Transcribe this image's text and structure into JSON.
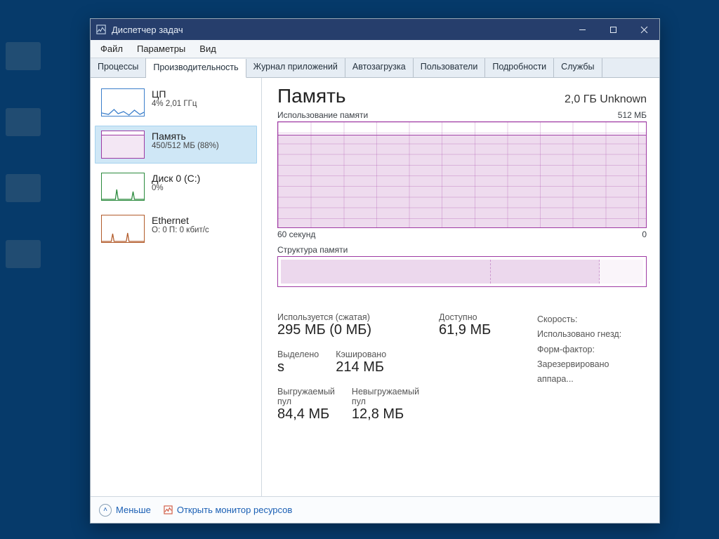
{
  "window": {
    "title": "Диспетчер задач"
  },
  "winctrl": {
    "min": "–",
    "max": "▢",
    "close": "✕"
  },
  "menu": {
    "file": "Файл",
    "options": "Параметры",
    "view": "Вид"
  },
  "tabs": {
    "processes": "Процессы",
    "performance": "Производительность",
    "app_history": "Журнал приложений",
    "startup": "Автозагрузка",
    "users": "Пользователи",
    "details": "Подробности",
    "services": "Службы"
  },
  "sidebar": {
    "cpu": {
      "title": "ЦП",
      "sub": "4% 2,01 ГГц"
    },
    "mem": {
      "title": "Память",
      "sub": "450/512 МБ (88%)"
    },
    "disk": {
      "title": "Диск 0 (C:)",
      "sub": "0%"
    },
    "net": {
      "title": "Ethernet",
      "sub": "О: 0 П: 0 кбит/с"
    }
  },
  "main": {
    "title": "Память",
    "installed": "2,0 ГБ Unknown",
    "usage_label": "Использование памяти",
    "usage_max": "512 МБ",
    "axis_left": "60 секунд",
    "axis_right": "0",
    "composition_label": "Структура памяти"
  },
  "stats": {
    "in_use_label": "Используется (сжатая)",
    "in_use_value": "295 МБ (0 МБ)",
    "avail_label": "Доступно",
    "avail_value": "61,9 МБ",
    "committed_label": "Выделено",
    "committed_value": "s",
    "cached_label": "Кэшировано",
    "cached_value": "214 МБ",
    "paged_label": "Выгружаемый пул",
    "paged_value": "84,4 МБ",
    "nonpaged_label": "Невыгружаемый пул",
    "nonpaged_value": "12,8 МБ",
    "right_list": {
      "speed": "Скорость:",
      "slots": "Использовано гнезд:",
      "form": "Форм-фактор:",
      "reserved": "Зарезервировано аппара..."
    }
  },
  "footer": {
    "fewer": "Меньше",
    "resmon": "Открыть монитор ресурсов"
  },
  "chart_data": {
    "type": "line",
    "title": "Использование памяти",
    "xlabel": "60 секунд",
    "ylabel": "",
    "ylim": [
      0,
      512
    ],
    "x": [
      60,
      55,
      50,
      45,
      40,
      35,
      30,
      25,
      20,
      15,
      10,
      5,
      0
    ],
    "values": [
      450,
      450,
      450,
      450,
      450,
      450,
      450,
      450,
      450,
      450,
      450,
      450,
      450
    ],
    "unit": "МБ",
    "fill_pct": 88
  },
  "composition_data": {
    "type": "bar",
    "segments": [
      {
        "name": "used",
        "pct": 58
      },
      {
        "name": "cached",
        "pct": 30
      },
      {
        "name": "free",
        "pct": 12
      }
    ]
  }
}
